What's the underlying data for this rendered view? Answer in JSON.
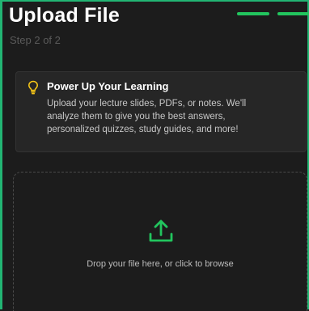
{
  "header": {
    "title": "Upload File",
    "step": "Step 2 of 2"
  },
  "tip_card": {
    "icon": "lightbulb-icon",
    "title": "Power Up Your Learning",
    "line1": "Upload your lecture slides, PDFs, or notes. We'll",
    "line2": "analyze them to give you the best answers,",
    "line3": "personalized quizzes, study guides, and more!"
  },
  "dropzone": {
    "icon": "upload-icon",
    "label": "Drop your file here, or click to browse"
  },
  "colors": {
    "accent": "#22c55e",
    "bulb": "#f5c518",
    "background": "#1c1c1c"
  }
}
